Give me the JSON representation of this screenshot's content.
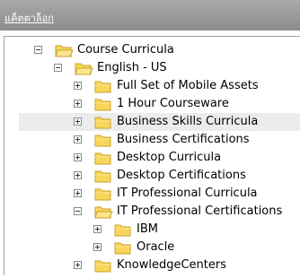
{
  "header": {
    "title": "แค็ตตาล็อก"
  },
  "tree": [
    {
      "label": "Course Curricula",
      "level": 0,
      "expanded": true,
      "icon": "folder-open-icon"
    },
    {
      "label": "English - US",
      "level": 1,
      "expanded": true,
      "icon": "folder-open-icon"
    },
    {
      "label": "Full Set of Mobile Assets",
      "level": 2,
      "expanded": false,
      "icon": "folder-icon"
    },
    {
      "label": "1 Hour Courseware",
      "level": 2,
      "expanded": false,
      "icon": "folder-icon"
    },
    {
      "label": "Business Skills Curricula",
      "level": 2,
      "expanded": false,
      "selected": true,
      "icon": "folder-icon"
    },
    {
      "label": "Business Certifications",
      "level": 2,
      "expanded": false,
      "icon": "folder-icon"
    },
    {
      "label": "Desktop Curricula",
      "level": 2,
      "expanded": false,
      "icon": "folder-icon"
    },
    {
      "label": "Desktop Certifications",
      "level": 2,
      "expanded": false,
      "icon": "folder-icon"
    },
    {
      "label": "IT Professional Curricula",
      "level": 2,
      "expanded": false,
      "icon": "folder-icon"
    },
    {
      "label": "IT Professional Certifications",
      "level": 2,
      "expanded": true,
      "icon": "folder-open-icon"
    },
    {
      "label": "IBM",
      "level": 3,
      "expanded": false,
      "icon": "folder-icon"
    },
    {
      "label": "Oracle",
      "level": 3,
      "expanded": false,
      "icon": "folder-icon"
    },
    {
      "label": "KnowledgeCenters",
      "level": 2,
      "expanded": false,
      "icon": "folder-icon"
    }
  ],
  "colors": {
    "header": "#999999",
    "selected_row": "#ececec",
    "folder_fill": "#f8d65a",
    "folder_stroke": "#c9a227"
  }
}
